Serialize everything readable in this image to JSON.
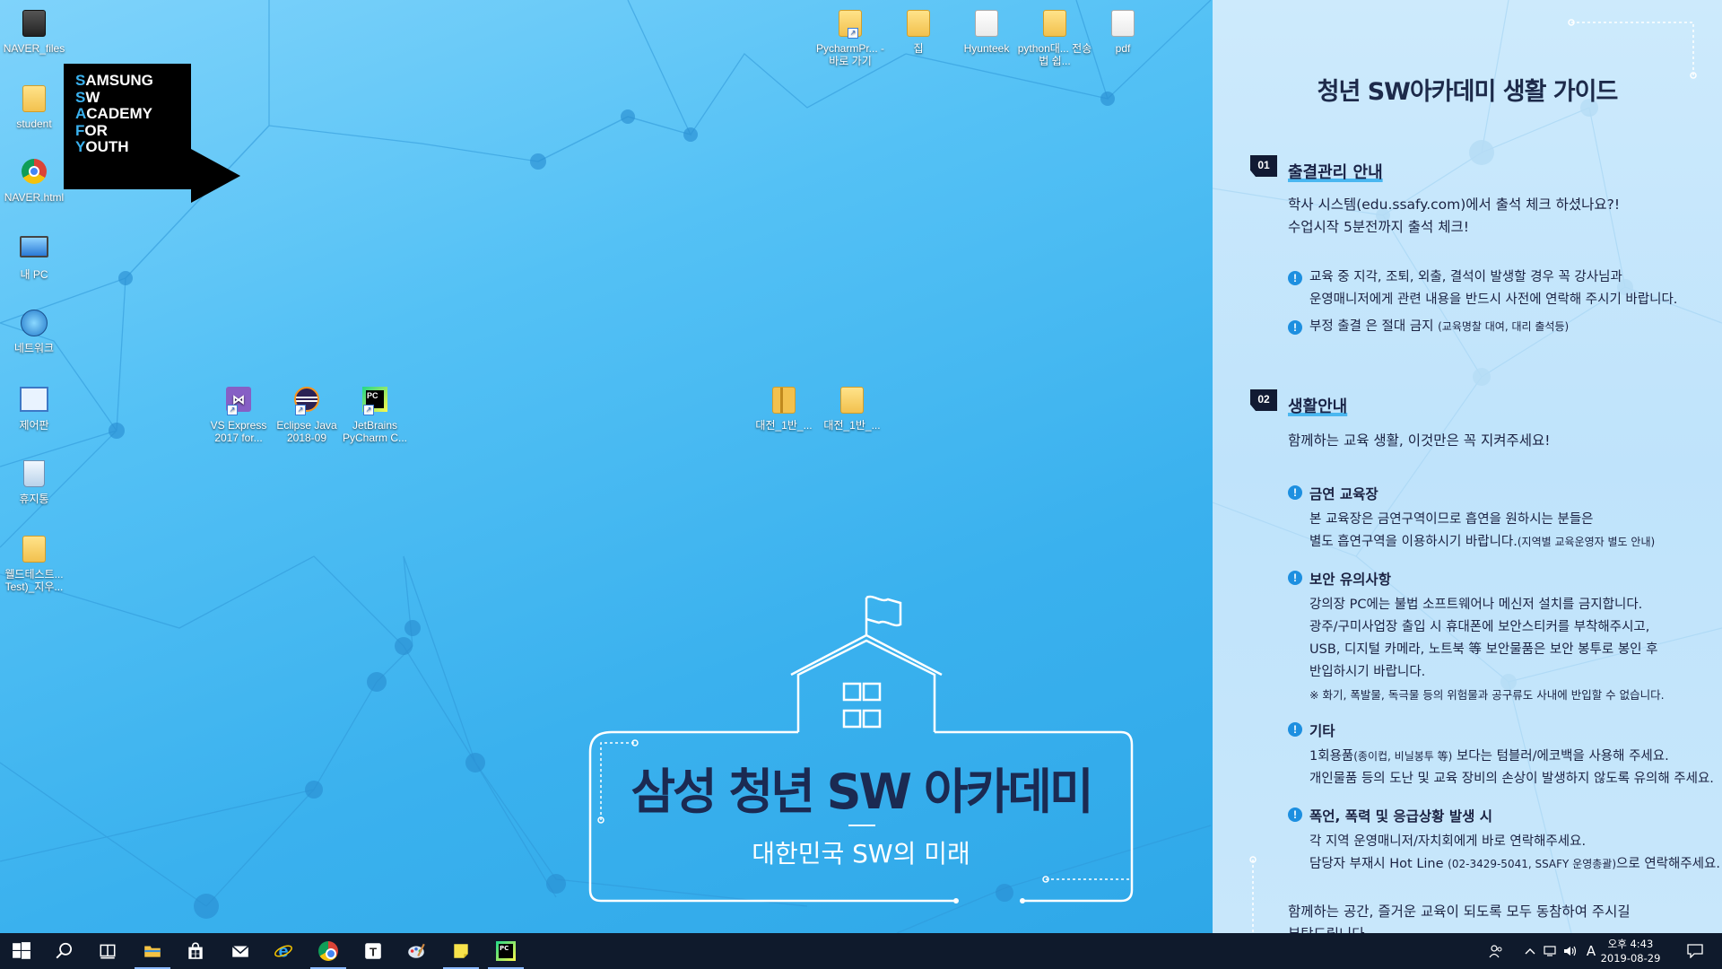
{
  "colors": {
    "desktop_bg": "#3cb2ee",
    "guide_bg": "#c8e7fb",
    "accent": "#1d8fe0",
    "taskbar": "#0f1a2c",
    "ssafy_navy": "#1b2a52"
  },
  "desktop": {
    "left_icons": [
      {
        "label": "NAVER_files",
        "icon": "folder-icon"
      },
      {
        "label": "student",
        "icon": "user-folder-icon"
      },
      {
        "label": "NAVER.html",
        "icon": "chrome-icon"
      },
      {
        "label": "내 PC",
        "icon": "this-pc-icon"
      },
      {
        "label": "네트워크",
        "icon": "network-icon"
      },
      {
        "label": "제어판",
        "icon": "control-panel-icon"
      },
      {
        "label": "휴지통",
        "icon": "recycle-bin-icon"
      },
      {
        "label": "웰드테스트... Test)_지우...",
        "icon": "folder-icon"
      }
    ],
    "top_icons": [
      {
        "label": "PycharmPr... - 바로 가기",
        "icon": "shortcut-folder-icon"
      },
      {
        "label": "집",
        "icon": "folder-icon"
      },
      {
        "label": "Hyunteek",
        "icon": "document-folder-icon"
      },
      {
        "label": "python대... 전송법 쉽...",
        "icon": "folder-icon"
      },
      {
        "label": "pdf",
        "icon": "document-folder-icon"
      }
    ],
    "middle_icons": [
      {
        "label": "VS Express 2017 for...",
        "icon": "visual-studio-icon"
      },
      {
        "label": "Eclipse Java 2018-09",
        "icon": "eclipse-icon"
      },
      {
        "label": "JetBrains PyCharm C...",
        "icon": "pycharm-icon"
      }
    ],
    "center_icons": [
      {
        "label": "대전_1반_...",
        "icon": "zip-folder-icon"
      },
      {
        "label": "대전_1반_...",
        "icon": "document-folder-icon"
      }
    ]
  },
  "logo": {
    "lines": [
      {
        "first": "S",
        "rest": "AMSUNG"
      },
      {
        "first": "S",
        "rest": "W"
      },
      {
        "first": "A",
        "rest": "CADEMY"
      },
      {
        "first": "F",
        "rest": "OR"
      },
      {
        "first": "Y",
        "rest": "OUTH"
      }
    ]
  },
  "school": {
    "title": "삼성 청년 SW 아카데미",
    "subtitle": "대한민국 SW의 미래"
  },
  "guide": {
    "title": "청년 SW아카데미 생활 가이드",
    "sec1": {
      "num": "01",
      "title": "출결관리 안내",
      "lines": [
        "학사 시스템(edu.ssafy.com)에서 출석 체크 하셨나요?!",
        "수업시작 5분전까지 출석 체크!"
      ],
      "b1": [
        "교육 중 지각, 조퇴, 외출, 결석이 발생할 경우 꼭 강사님과",
        "운영매니저에게 관련 내용을 반드시 사전에 연락해 주시기 바랍니다."
      ],
      "b2_main": "부정 출결 은 절대 금지",
      "b2_note": "(교육명찰 대여, 대리 출석등)"
    },
    "sec2": {
      "num": "02",
      "title": "생활안내",
      "intro": "함께하는 교육 생활, 이것만은 꼭 지켜주세요!",
      "smoke_title": "금연 교육장",
      "smoke_lines": [
        "본 교육장은 금연구역이므로 흡연을 원하시는 분들은",
        "별도 흡연구역을 이용하시기 바랍니다."
      ],
      "smoke_note": "(지역별 교육운영자 별도 안내)",
      "sec_title": "보안 유의사항",
      "sec_lines": [
        "강의장 PC에는 불법 소프트웨어나 메신저 설치를 금지합니다.",
        "광주/구미사업장 출입 시 휴대폰에 보안스티커를 부착해주시고,",
        "USB, 디지털 카메라, 노트북 等 보안물품은 보안 봉투로 봉인 후",
        "반입하시기 바랍니다."
      ],
      "sec_note": "※ 화기, 폭발물, 독극물 등의 위험물과 공구류도 사내에 반입할 수 없습니다.",
      "etc_title": "기타",
      "etc_l1_a": "1회용품",
      "etc_l1_note": "(종이컵, 비닐봉투 等)",
      "etc_l1_b": " 보다는 텀블러/에코백을 사용해 주세요.",
      "etc_l2": "개인물품 등의 도난 및 교육 장비의 손상이 발생하지 않도록 유의해 주세요.",
      "emg_title": "폭언, 폭력 및 응급상황 발생 시",
      "emg_l1": "각 지역 운영매니저/자치회에게 바로 연락해주세요.",
      "emg_l2_a": "담당자 부재시 Hot Line ",
      "emg_l2_note": "(02-3429-5041,  SSAFY 운영총괄)",
      "emg_l2_b": "으로 연락해주세요.",
      "closing1": "함께하는 공간, 즐거운 교육이 되도록 모두 동참하여 주시길",
      "closing2": "부탁드립니다."
    }
  },
  "taskbar": {
    "apps": [
      {
        "name": "start-button",
        "icon": "windows-logo-icon"
      },
      {
        "name": "search-button",
        "icon": "search-icon"
      },
      {
        "name": "task-view-button",
        "icon": "task-view-icon"
      },
      {
        "name": "taskbar-file-explorer",
        "icon": "file-explorer-icon"
      },
      {
        "name": "taskbar-store",
        "icon": "store-icon"
      },
      {
        "name": "taskbar-mail",
        "icon": "mail-icon"
      },
      {
        "name": "taskbar-ie",
        "icon": "internet-explorer-icon"
      },
      {
        "name": "taskbar-chrome",
        "icon": "chrome-icon"
      },
      {
        "name": "taskbar-typora",
        "icon": "typora-icon"
      },
      {
        "name": "taskbar-paint",
        "icon": "paint-icon"
      },
      {
        "name": "taskbar-sticky-notes",
        "icon": "sticky-notes-icon"
      },
      {
        "name": "taskbar-pycharm",
        "icon": "pycharm-icon"
      }
    ],
    "ime": "A",
    "time": "오후 4:43",
    "date": "2019-08-29"
  }
}
